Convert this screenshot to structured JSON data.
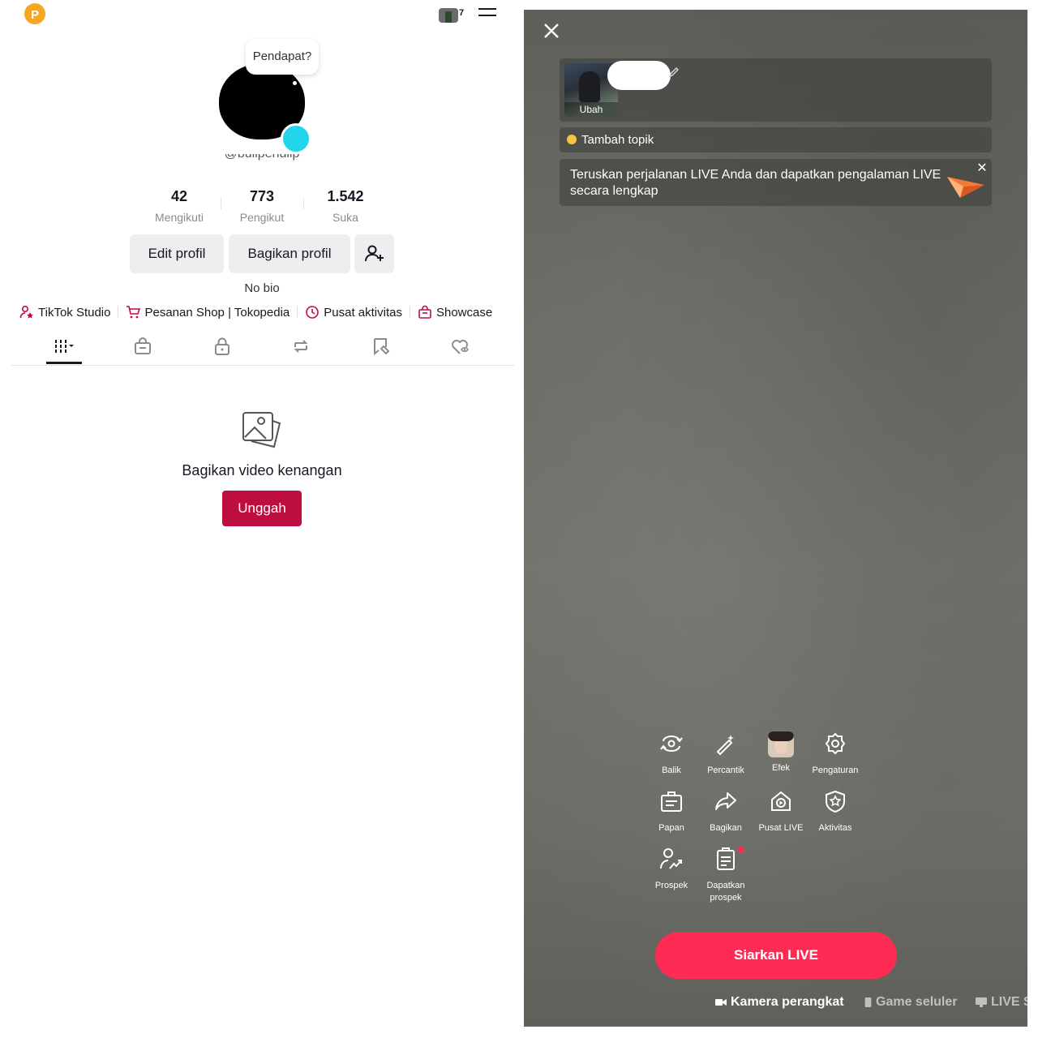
{
  "profile": {
    "tooltip": "Pendapat?",
    "notification_count": "7",
    "stats": [
      {
        "value": "42",
        "label": "Mengikuti"
      },
      {
        "value": "773",
        "label": "Pengikut"
      },
      {
        "value": "1.542",
        "label": "Suka"
      }
    ],
    "buttons": {
      "edit": "Edit profil",
      "share": "Bagikan profil"
    },
    "bio": "No bio",
    "quick_links": [
      "TikTok Studio",
      "Pesanan Shop | Tokopedia",
      "Pusat aktivitas",
      "Showcase"
    ],
    "tab_icons": [
      "grid-filter-icon",
      "shopping-bag-icon",
      "lock-icon",
      "repost-icon",
      "tagged-post-icon",
      "liked-heart-icon"
    ],
    "empty_state": {
      "title": "Bagikan video kenangan",
      "button": "Unggah"
    },
    "accent_color": "#be0d3f"
  },
  "live": {
    "cover_label": "Ubah",
    "topic": "Tambah topik",
    "banner": "Teruskan perjalanan LIVE Anda dan dapatkan pengalaman LIVE secara lengkap",
    "tools": [
      {
        "label": "Balik",
        "icon": "flip-camera-icon"
      },
      {
        "label": "Percantik",
        "icon": "beauty-wand-icon"
      },
      {
        "label": "Efek",
        "icon": "effects-thumbnail-icon"
      },
      {
        "label": "Pengaturan",
        "icon": "settings-gear-icon"
      },
      {
        "label": "Papan",
        "icon": "board-icon"
      },
      {
        "label": "Bagikan",
        "icon": "share-arrow-icon"
      },
      {
        "label": "Pusat LIVE",
        "icon": "live-center-icon"
      },
      {
        "label": "Aktivitas",
        "icon": "activity-shield-icon"
      },
      {
        "label": "Prospek",
        "icon": "prospect-user-icon"
      },
      {
        "label": "Dapatkan prospek",
        "icon": "get-prospect-clipboard-icon"
      }
    ],
    "go_live_button": "Siarkan LIVE",
    "bottom_tabs": [
      "Kamera perangkat",
      "Game seluler",
      "LIVE S"
    ],
    "accent_color": "#fe2c55"
  }
}
